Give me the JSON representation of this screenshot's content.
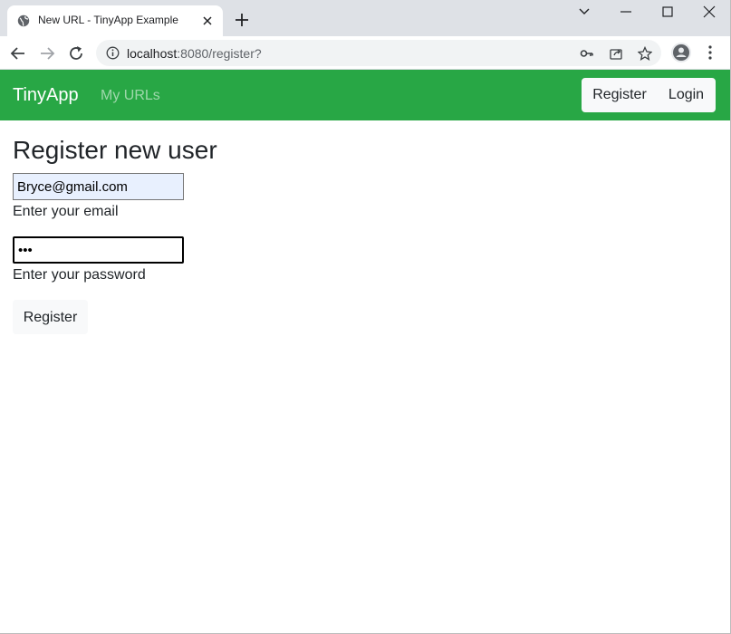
{
  "browser": {
    "tab": {
      "title": "New URL - TinyApp Example",
      "favicon": "globe-icon"
    },
    "address": {
      "host": "localhost",
      "rest": ":8080/register?"
    },
    "icons": [
      "key-icon",
      "share-icon",
      "star-icon",
      "profile-icon",
      "menu-icon"
    ]
  },
  "navbar": {
    "brand": "TinyApp",
    "links": [
      {
        "label": "My URLs"
      }
    ],
    "register_label": "Register",
    "login_label": "Login",
    "bg_color": "#28a745"
  },
  "form": {
    "heading": "Register new user",
    "email_value": "Bryce@gmail.com",
    "email_hint": "Enter your email",
    "password_value": "•••",
    "password_hint": "Enter your password",
    "submit_label": "Register"
  }
}
